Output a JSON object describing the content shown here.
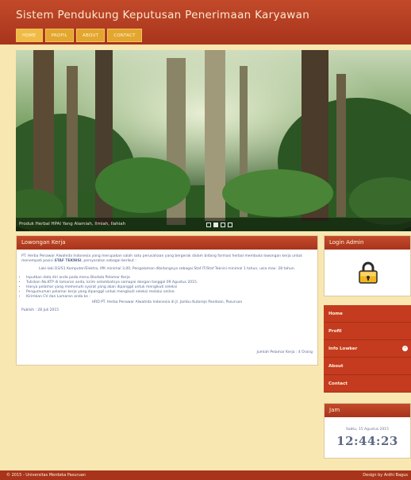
{
  "header": {
    "title": "Sistem Pendukung Keputusan Penerimaan Karyawan",
    "nav": [
      "HOME",
      "PROFIL",
      "ABOUT",
      "CONTACT"
    ]
  },
  "slider": {
    "caption": "Produk Herbal HPAI Yang Alamiah, Ilmiah, Ilahiah",
    "active_slide": 2,
    "total_slides": 4
  },
  "lowongan": {
    "title": "Lowongan Kerja",
    "intro_before": "PT. Herba Penawar Alwahida Indonesia yang merupakan salah satu perusahaan yang bergerak dalam bidang farmasi herbal membuka lowongan kerja untuk menempati posisi ",
    "position": "STAF TEKNISI",
    "intro_after": ", persyaratan sebagai berikut :",
    "requirement": "Laki-laki D3/S1 Komputer/Elektro, IPK minimal 3,00, Pengalaman dibidangnya sebagai Staf IT/Staf Teknisi minimal 1 tahun, usia max. 28 tahun.",
    "steps": [
      "Inputkan data diri anda pada menu Biodata Pelamar Kerja",
      "Tuliskan No.KTP di lamaran anda, kirim selambatnya samapai dengan tanggal 09 Agustus 2015.",
      "Hanya pelamar yang memenuhi syarat yang akan dipanggil untuk mengikuti seleksi",
      "Pengumuman pelamar kerja yang dipanggil untuk mengikuti seleksi melalui online.",
      "Kirimkan CV dan Lamaran anda ke :"
    ],
    "address": "HRD PT. Herba Penawar Alwahida Indonesia di Jl. Jambu Kutorejo Pandaan, Pasuruan",
    "publish": "Publish : 28 Juli 2015",
    "count": "Jumlah Pelamar Kerja : 4 Orang"
  },
  "login": {
    "title": "Login Admin",
    "icon": "lock-icon"
  },
  "menu": [
    "Home",
    "Profil",
    "Info Lowker",
    "About",
    "Contact"
  ],
  "jam": {
    "title": "Jam",
    "date": "Sabtu, 15 Agustus 2015",
    "time": "12:44:23"
  },
  "footer": {
    "left": "© 2015 - Universitas Merdeka Pasuruan",
    "right": "Design by Ardhi Bagus"
  },
  "colors": {
    "header": "#a8341c",
    "accent": "#e3a62e",
    "background": "#f8e7b0",
    "menu": "#c43b1f"
  }
}
